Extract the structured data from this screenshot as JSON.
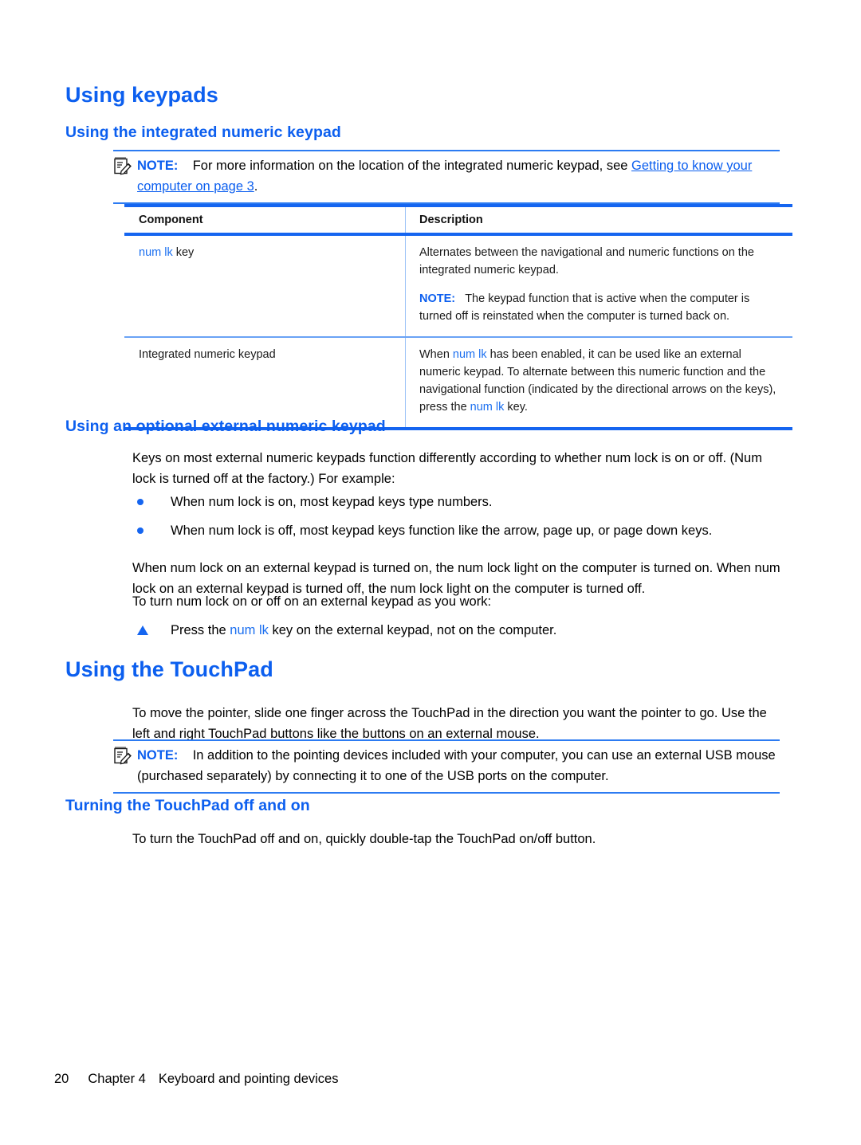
{
  "document": {
    "heading_color": "#0C5FEF",
    "rule_color": "#1565F0",
    "keyterm_color": "#1B6FF0"
  },
  "sections": {
    "using_keypads": {
      "title": "Using keypads",
      "subtitle": "Using the integrated numeric keypad",
      "note": {
        "label": "NOTE:",
        "text_before": "For more information on the location of the integrated numeric keypad, see ",
        "link": "Getting to know your computer on page 3",
        "text_after": "."
      }
    },
    "external_keypad": {
      "title": "Using an optional external numeric keypad",
      "intro": "Keys on most external numeric keypads function differently according to whether num lock is on or off. (Num lock is turned off at the factory.) For example:",
      "bullets": [
        "When num lock is on, most keypad keys type numbers.",
        "When num lock is off, most keypad keys function like the arrow, page up, or page down keys."
      ],
      "paragraph1": "When num lock on an external keypad is turned on, the num lock light on the computer is turned on. When num lock on an external keypad is turned off, the num lock light on the computer is turned off.",
      "paragraph2": "To turn num lock on or off on an external keypad as you work:",
      "step": {
        "before": "Press the ",
        "keyterm": "num lk",
        "after": " key on the external keypad, not on the computer."
      }
    },
    "touchpad": {
      "title": "Using the TouchPad",
      "paragraph": "To move the pointer, slide one finger across the TouchPad in the direction you want the pointer to go. Use the left and right TouchPad buttons like the buttons on an external mouse.",
      "note": {
        "label": "NOTE:",
        "text": "In addition to the pointing devices included with your computer, you can use an external USB mouse (purchased separately) by connecting it to one of the USB ports on the computer."
      }
    },
    "touchpad_off_on": {
      "title": "Turning the TouchPad off and on",
      "paragraph": "To turn the TouchPad off and on, quickly double-tap the TouchPad on/off button."
    }
  },
  "table": {
    "headers": {
      "component": "Component",
      "description": "Description"
    },
    "rows": [
      {
        "component_keyterm": "num lk",
        "component_suffix": " key",
        "description_p1": "Alternates between the navigational and numeric functions on the integrated numeric keypad.",
        "description_note_label": "NOTE:",
        "description_note": "The keypad function that is active when the computer is turned off is reinstated when the computer is turned back on."
      },
      {
        "component": "Integrated numeric keypad",
        "desc_part1": "When ",
        "desc_key1": "num lk",
        "desc_part2": " has been enabled, it can be used like an external numeric keypad. To alternate between this numeric function and the navigational function (indicated by the directional arrows on the keys), press the ",
        "desc_key2": "num lk",
        "desc_part3": " key."
      }
    ]
  },
  "footer": {
    "page_number": "20",
    "chapter": "Chapter 4",
    "chapter_title": "Keyboard and pointing devices"
  }
}
